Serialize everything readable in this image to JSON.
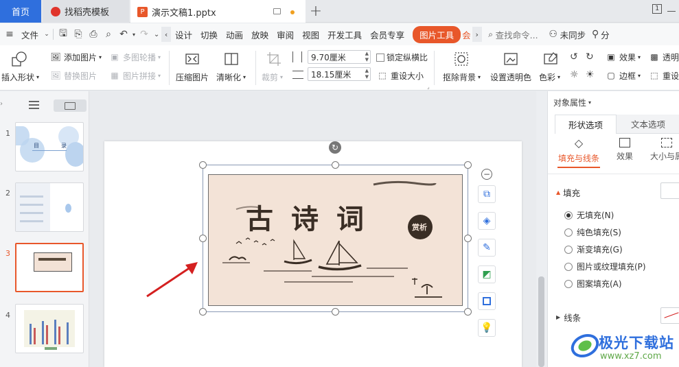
{
  "tabs": {
    "home": "首页",
    "template": "找稻壳模板",
    "document": "演示文稿1.pptx",
    "add": "+"
  },
  "window": {
    "restore_label": "1"
  },
  "menu": {
    "file": "文件",
    "items": [
      "设计",
      "切换",
      "动画",
      "放映",
      "审阅",
      "视图",
      "开发工具",
      "会员专享"
    ],
    "picture_tools": "图片工具",
    "more": "会",
    "search_placeholder": "查找命令...",
    "sync": "未同步",
    "share": "分"
  },
  "ribbon": {
    "insert_shape": "插入形状",
    "add_picture": "添加图片",
    "replace_picture": "替换图片",
    "multi_carousel": "多图轮播",
    "picture_collage": "图片拼接",
    "compress_picture": "压缩图片",
    "sharpen": "清晰化",
    "crop": "裁剪",
    "height_value": "9.70厘米",
    "width_value": "18.15厘米",
    "lock_ratio": "锁定纵横比",
    "reset_size": "重设大小",
    "remove_background": "抠除背景",
    "set_transparency": "设置透明色",
    "color": "色彩",
    "effects": "效果",
    "border": "边框",
    "transparency": "透明",
    "reset": "重设"
  },
  "slides": {
    "numbers": [
      "1",
      "2",
      "3",
      "4"
    ],
    "slide1_title": "目",
    "slide1_title2": "录",
    "selected_index": 3
  },
  "slide_picture": {
    "calligraphy": "古诗词",
    "seal": "赏析"
  },
  "right_panel": {
    "header": "对象属性",
    "tab_shape": "形状选项",
    "tab_text": "文本选项",
    "sub_fill_line": "填充与线条",
    "sub_effects": "效果",
    "sub_size": "大小与属",
    "fill_section": "填充",
    "fill_options": [
      "无填充(N)",
      "纯色填充(S)",
      "渐变填充(G)",
      "图片或纹理填充(P)",
      "图案填充(A)"
    ],
    "fill_selected": 0,
    "line_section": "线条"
  },
  "watermark": {
    "name": "极光下载站",
    "url": "www.xz7.com"
  },
  "colors": {
    "accent": "#e8572a",
    "home_tab": "#2f6fdd",
    "arrow": "#d42020"
  }
}
